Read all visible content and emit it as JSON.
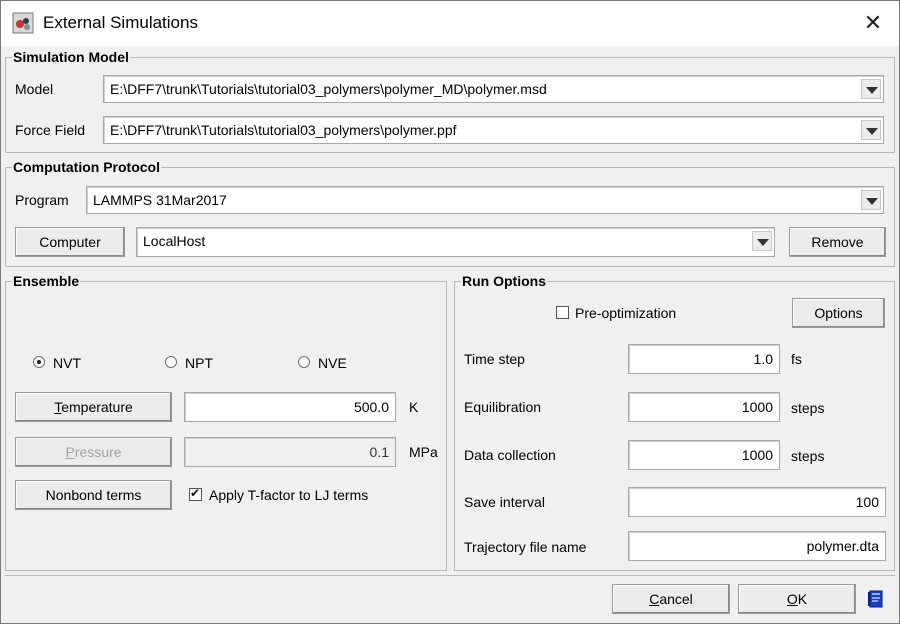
{
  "window": {
    "title": "External Simulations",
    "close_glyph": "✕",
    "icons": {
      "app": "app-icon",
      "close": "close-icon",
      "help": "help-book-icon"
    }
  },
  "simulation_model": {
    "legend": "Simulation Model",
    "model_label": "Model",
    "model_value": "E:\\DFF7\\trunk\\Tutorials\\tutorial03_polymers\\polymer_MD\\polymer.msd",
    "forcefield_label": "Force Field",
    "forcefield_value": "E:\\DFF7\\trunk\\Tutorials\\tutorial03_polymers\\polymer.ppf"
  },
  "computation_protocol": {
    "legend": "Computation Protocol",
    "program_label": "Program",
    "program_value": "LAMMPS 31Mar2017",
    "computer_button": "Computer",
    "computer_value": "LocalHost",
    "remove_button": "Remove"
  },
  "ensemble": {
    "legend": "Ensemble",
    "options": [
      {
        "label": "NVT",
        "selected": true
      },
      {
        "label": "NPT",
        "selected": false
      },
      {
        "label": "NVE",
        "selected": false
      }
    ],
    "temperature": {
      "button_first": "T",
      "button_rest": "emperature",
      "value": "500.0",
      "unit": "K"
    },
    "pressure": {
      "button_first": "P",
      "button_rest": "ressure",
      "value": "0.1",
      "unit": "MPa",
      "enabled": false
    },
    "nonbond_button": "Nonbond terms",
    "apply_tfactor_label": "Apply T-factor to LJ terms",
    "apply_tfactor_checked": true
  },
  "run_options": {
    "legend": "Run Options",
    "preopt_label": "Pre-optimization",
    "preopt_checked": false,
    "options_button": "Options",
    "time_step_label": "Time step",
    "time_step_value": "1.0",
    "time_step_unit": "fs",
    "equilibration_label": "Equilibration",
    "equilibration_value": "1000",
    "equilibration_unit": "steps",
    "data_collection_label": "Data collection",
    "data_collection_value": "1000",
    "data_collection_unit": "steps",
    "save_interval_label": "Save interval",
    "save_interval_value": "100",
    "trajectory_label": "Trajectory file name",
    "trajectory_value": "polymer.dta"
  },
  "footer": {
    "cancel_first": "C",
    "cancel_rest": "ancel",
    "ok_first": "O",
    "ok_rest": "K"
  }
}
